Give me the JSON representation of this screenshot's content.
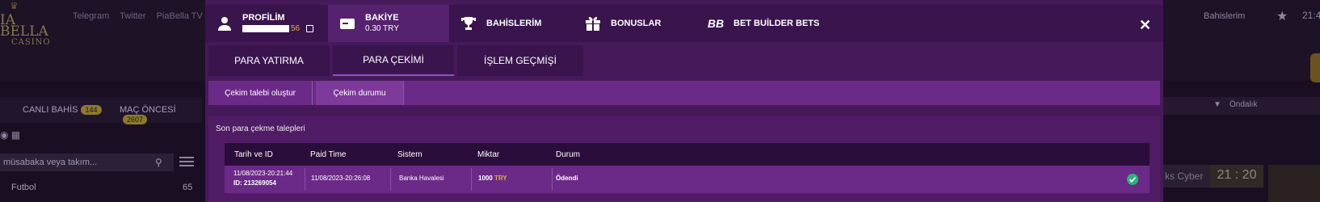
{
  "background": {
    "logo_line1": "IA BELLA",
    "logo_line2": "CASINO",
    "nav": [
      "Telegram",
      "Twitter",
      "PiaBella TV"
    ],
    "right_menu": "Bahislerim",
    "top_time": "21:4",
    "tabs": {
      "live_label": "CANLI BAHİS",
      "live_count": "144",
      "pre_label": "MAÇ ÖNCESİ",
      "pre_count": "2607"
    },
    "search_placeholder": "müsabaka veya takım...",
    "sport_item": {
      "label": "Futbol",
      "count": "65"
    },
    "right_bar_label": "Öndalık",
    "cyber_label": "ks Cyber",
    "clock": "21 : 20"
  },
  "modal": {
    "topnav": {
      "profile": {
        "title": "PROFİLİM",
        "masked_id_suffix": "56"
      },
      "balance": {
        "title": "BAKİYE",
        "value": "0.30 TRY"
      },
      "bets": "BAHİSLERİM",
      "bonuses": "BONUSLAR",
      "betbuilder": "BET BUİLDER BETS",
      "close": "✕"
    },
    "subtabs": [
      "PARA YATIRMA",
      "PARA ÇEKİMİ",
      "İŞLEM GEÇMİŞİ"
    ],
    "withdraw_tabs": [
      "Çekim talebi oluştur",
      "Çekim durumu"
    ],
    "panel_title": "Son para çekme talepleri",
    "table": {
      "headers": [
        "Tarih ve ID",
        "Paid Time",
        "Sistem",
        "Miktar",
        "Durum"
      ],
      "rows": [
        {
          "date": "11/08/2023-20:21:44",
          "id": "ID: 213269054",
          "paid_time": "11/08/2023-20:26:08",
          "system": "Banka Havalesi",
          "amount": "1000",
          "currency": "TRY",
          "status": "Ödendi"
        }
      ]
    }
  },
  "colors": {
    "modal_bg": "#461a5a",
    "accent_gold": "#e0b240",
    "success": "#2bb37a"
  }
}
